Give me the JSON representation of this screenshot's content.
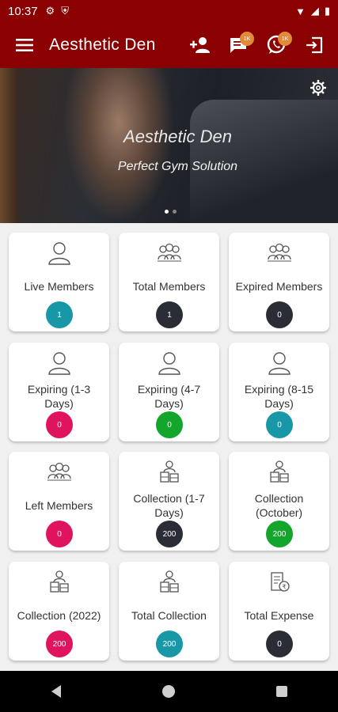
{
  "status_bar": {
    "time": "10:37"
  },
  "app_bar": {
    "title": "Aesthetic Den",
    "chat_badge": "1K",
    "whatsapp_badge": "1K"
  },
  "banner": {
    "title": "Aesthetic Den",
    "subtitle": "Perfect Gym Solution"
  },
  "cards": [
    {
      "label": "Live Members",
      "count": "1",
      "color": "#1897a6",
      "icon": "person-icon"
    },
    {
      "label": "Total Members",
      "count": "1",
      "color": "#2a2d36",
      "icon": "group-icon"
    },
    {
      "label": "Expired Members",
      "count": "0",
      "color": "#2a2d36",
      "icon": "group-icon"
    },
    {
      "label": "Expiring (1-3 Days)",
      "count": "0",
      "color": "#e0135e",
      "icon": "person-icon"
    },
    {
      "label": "Expiring (4-7 Days)",
      "count": "0",
      "color": "#13a52c",
      "icon": "person-icon"
    },
    {
      "label": "Expiring (8-15 Days)",
      "count": "0",
      "color": "#1897a6",
      "icon": "person-icon"
    },
    {
      "label": "Left Members",
      "count": "0",
      "color": "#e0135e",
      "icon": "group-icon"
    },
    {
      "label": "Collection (1-7 Days)",
      "count": "200",
      "color": "#2a2d36",
      "icon": "collection-icon"
    },
    {
      "label": "Collection (October)",
      "count": "200",
      "color": "#13a52c",
      "icon": "collection-icon"
    },
    {
      "label": "Collection (2022)",
      "count": "200",
      "color": "#e0135e",
      "icon": "collection-icon"
    },
    {
      "label": "Total Collection",
      "count": "200",
      "color": "#1897a6",
      "icon": "collection-icon"
    },
    {
      "label": "Total Expense",
      "count": "0",
      "color": "#2a2d36",
      "icon": "expense-icon"
    }
  ]
}
